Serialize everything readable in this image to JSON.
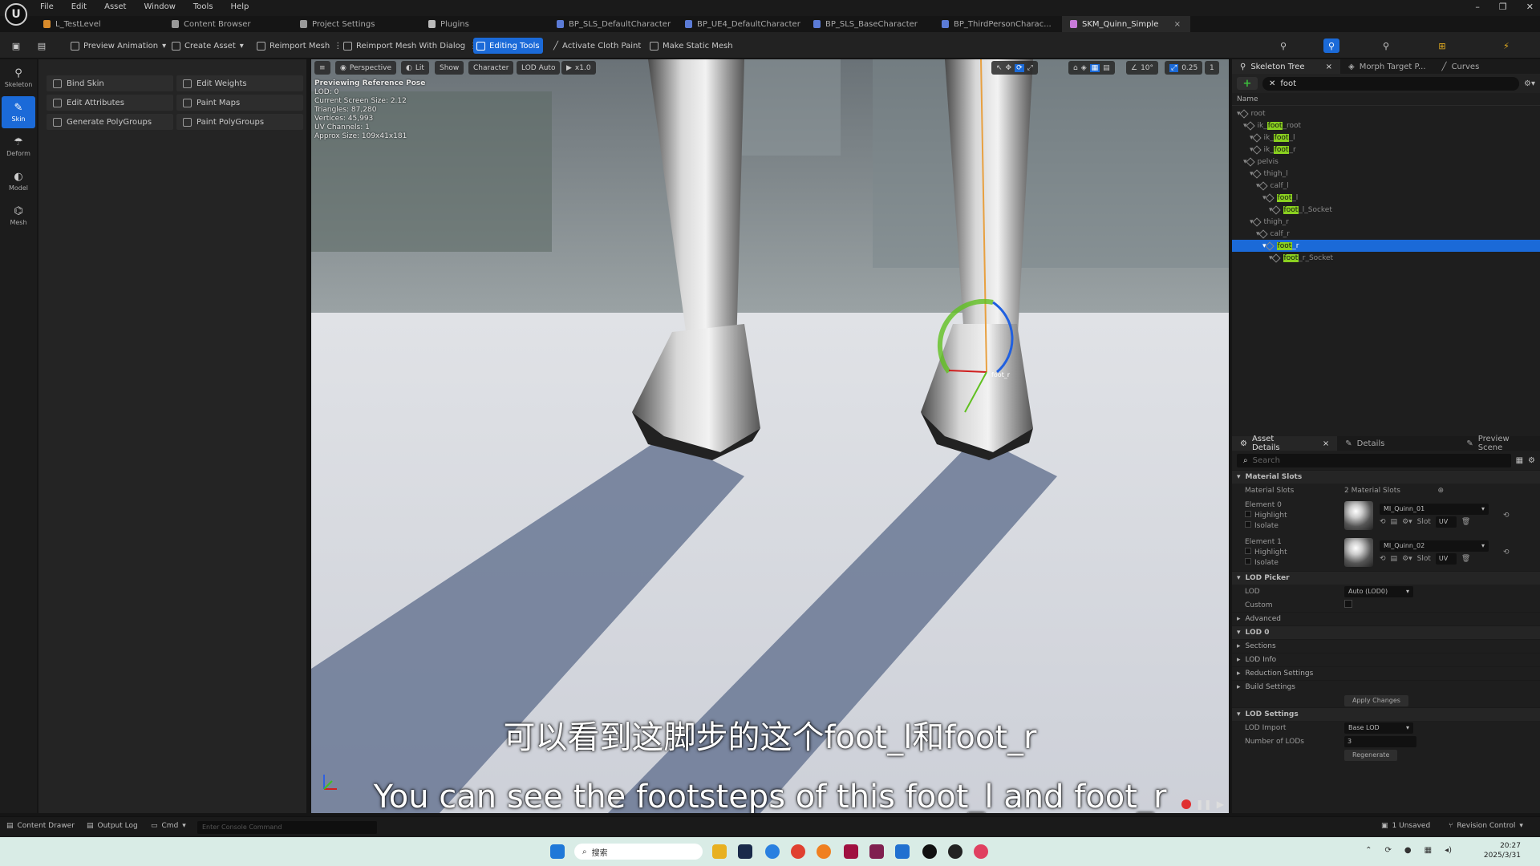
{
  "menu": [
    "File",
    "Edit",
    "Asset",
    "Window",
    "Tools",
    "Help"
  ],
  "tabs": [
    {
      "label": "L_TestLevel",
      "kind": "lvl"
    },
    {
      "label": "Content Browser",
      "kind": "gear"
    },
    {
      "label": "Project Settings",
      "kind": "gear"
    },
    {
      "label": "Plugins",
      "kind": "plug"
    },
    {
      "label": "BP_SLS_DefaultCharacter",
      "kind": "bp"
    },
    {
      "label": "BP_UE4_DefaultCharacter",
      "kind": "bp"
    },
    {
      "label": "BP_SLS_BaseCharacter",
      "kind": "bp"
    },
    {
      "label": "BP_ThirdPersonCharac...",
      "kind": "bp"
    },
    {
      "label": "SKM_Quinn_Simple",
      "kind": "skm",
      "active": true
    }
  ],
  "toolbar": {
    "preview_animation": "Preview Animation",
    "create_asset": "Create Asset",
    "reimport_mesh": "Reimport Mesh",
    "reimport_dialog": "Reimport Mesh With Dialog",
    "editing_tools": "Editing Tools",
    "activate_cloth": "Activate Cloth Paint",
    "make_static": "Make Static Mesh"
  },
  "modes": [
    {
      "label": "Skeleton",
      "glyph": "⚲"
    },
    {
      "label": "Skin",
      "glyph": "✎",
      "active": true
    },
    {
      "label": "Deform",
      "glyph": "☂"
    },
    {
      "label": "Model",
      "glyph": "◐"
    },
    {
      "label": "Mesh",
      "glyph": "⌬"
    }
  ],
  "tools": {
    "bind_skin": "Bind Skin",
    "edit_weights": "Edit Weights",
    "edit_attributes": "Edit Attributes",
    "paint_maps": "Paint Maps",
    "generate_polygroups": "Generate PolyGroups",
    "paint_polygroups": "Paint PolyGroups"
  },
  "viewport": {
    "menu": "≡",
    "perspective": "Perspective",
    "lit": "Lit",
    "show": "Show",
    "character": "Character",
    "lod": "LOD Auto",
    "speed": "x1.0",
    "angle": "10°",
    "scale": "0.25",
    "cam": "1",
    "stats_title": "Previewing Reference Pose",
    "stats": [
      "LOD: 0",
      "Current Screen Size: 2.12",
      "Triangles: 87,280",
      "Vertices: 45,993",
      "UV Channels: 1",
      "Approx Size: 109x41x181"
    ],
    "subtitle_cn": "可以看到这脚步的这个foot_l和foot_r",
    "subtitle_en": "You can see the footsteps of this foot_l and foot_r",
    "bone_label": "foot_r"
  },
  "skeleton_tree": {
    "tabs": [
      "Skeleton Tree",
      "Morph Target P...",
      "Curves"
    ],
    "search": "foot",
    "header": "Name",
    "nodes": [
      {
        "indent": 0,
        "pre": "root",
        "hl": "",
        "post": "",
        "sel": false
      },
      {
        "indent": 1,
        "pre": "ik_",
        "hl": "foot",
        "post": "_root",
        "sel": false
      },
      {
        "indent": 2,
        "pre": "ik_",
        "hl": "foot",
        "post": "_l",
        "sel": false
      },
      {
        "indent": 2,
        "pre": "ik_",
        "hl": "foot",
        "post": "_r",
        "sel": false
      },
      {
        "indent": 1,
        "pre": "pelvis",
        "hl": "",
        "post": "",
        "sel": false
      },
      {
        "indent": 2,
        "pre": "thigh_l",
        "hl": "",
        "post": "",
        "sel": false
      },
      {
        "indent": 3,
        "pre": "calf_l",
        "hl": "",
        "post": "",
        "sel": false
      },
      {
        "indent": 4,
        "pre": "",
        "hl": "foot",
        "post": "_l",
        "sel": false
      },
      {
        "indent": 5,
        "pre": "",
        "hl": "foot",
        "post": "_l_Socket",
        "sel": false
      },
      {
        "indent": 2,
        "pre": "thigh_r",
        "hl": "",
        "post": "",
        "sel": false
      },
      {
        "indent": 3,
        "pre": "calf_r",
        "hl": "",
        "post": "",
        "sel": false
      },
      {
        "indent": 4,
        "pre": "",
        "hl": "foot",
        "post": "_r",
        "sel": true
      },
      {
        "indent": 5,
        "pre": "",
        "hl": "foot",
        "post": "_r_Socket",
        "sel": false
      }
    ]
  },
  "details": {
    "tabs": [
      "Asset Details",
      "Details",
      "Preview Scene"
    ],
    "search_placeholder": "Search",
    "material_slots_section": "Material Slots",
    "material_slots_label": "Material Slots",
    "material_slots_count": "2 Material Slots",
    "elements": [
      {
        "label": "Element 0",
        "material": "MI_Quinn_01",
        "highlight": "Highlight",
        "isolate": "Isolate"
      },
      {
        "label": "Element 1",
        "material": "MI_Quinn_02",
        "highlight": "Highlight",
        "isolate": "Isolate"
      }
    ],
    "slot_label": "Slot",
    "slot_value": "UV",
    "lod_picker_section": "LOD Picker",
    "lod_label": "LOD",
    "lod_value": "Auto (LOD0)",
    "custom_label": "Custom",
    "advanced_label": "Advanced",
    "lod0_section": "LOD 0",
    "lod0_items": [
      "Sections",
      "LOD Info",
      "Reduction Settings",
      "Build Settings"
    ],
    "apply_changes": "Apply Changes",
    "lod_settings_section": "LOD Settings",
    "lod_import_label": "LOD Import",
    "lod_import_value": "Base LOD",
    "num_lods_label": "Number of LODs",
    "num_lods_value": "3",
    "regenerate": "Regenerate"
  },
  "status": {
    "content_drawer": "Content Drawer",
    "output_log": "Output Log",
    "cmd": "Cmd",
    "console_placeholder": "Enter Console Command",
    "unsaved": "1 Unsaved",
    "revision": "Revision Control"
  },
  "taskbar": {
    "search": "搜索",
    "time": "20:27",
    "date": "2025/3/31"
  },
  "colors": {
    "accent": "#1b6ad8",
    "highlight": "#8ad020"
  }
}
